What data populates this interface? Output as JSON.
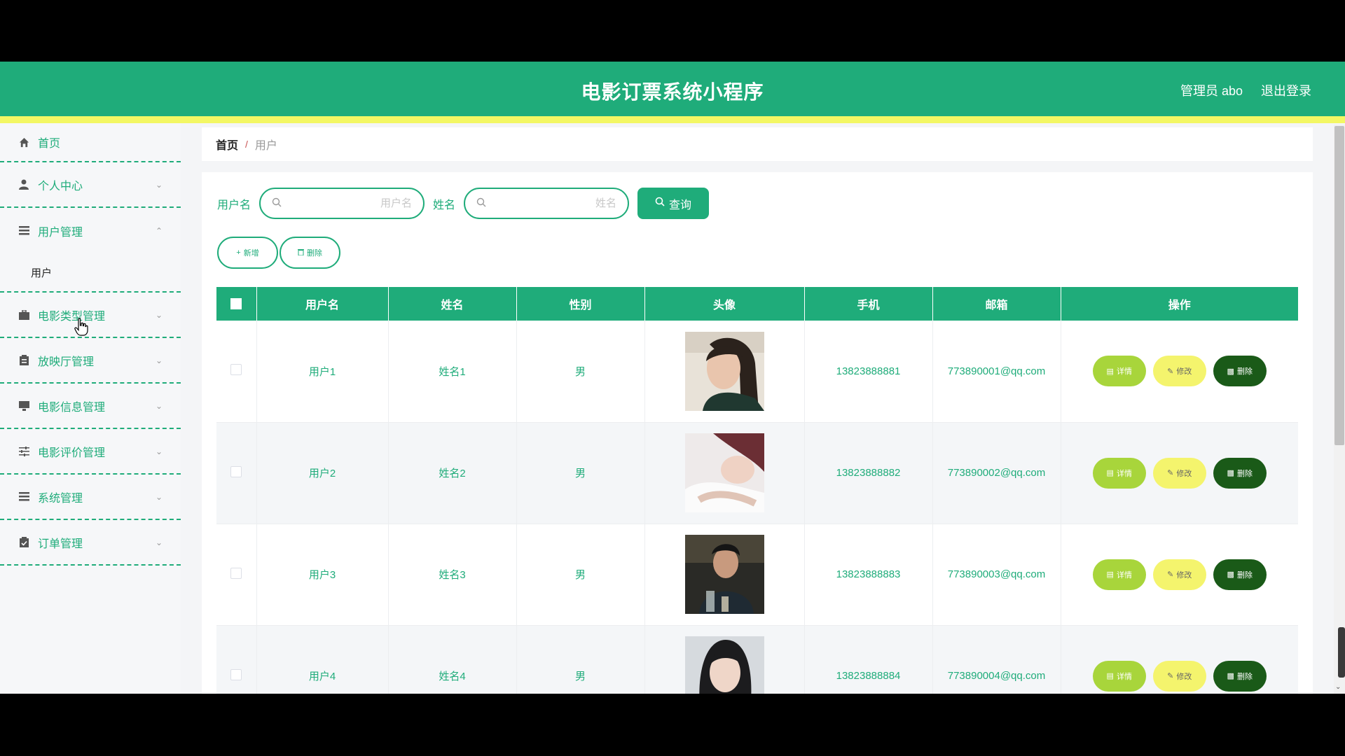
{
  "header": {
    "title": "电影订票系统小程序",
    "admin_label": "管理员 abo",
    "logout_label": "退出登录"
  },
  "sidebar": {
    "items": [
      {
        "label": "首页",
        "icon": "home-icon"
      },
      {
        "label": "个人中心",
        "icon": "user-icon"
      },
      {
        "label": "用户管理",
        "icon": "list-icon",
        "expanded": true,
        "sub": [
          "用户"
        ]
      },
      {
        "label": "电影类型管理",
        "icon": "briefcase-icon"
      },
      {
        "label": "放映厅管理",
        "icon": "clipboard-icon"
      },
      {
        "label": "电影信息管理",
        "icon": "monitor-icon"
      },
      {
        "label": "电影评价管理",
        "icon": "sliders-icon"
      },
      {
        "label": "系统管理",
        "icon": "list-icon"
      },
      {
        "label": "订单管理",
        "icon": "clipboard-check-icon"
      }
    ]
  },
  "breadcrumb": {
    "home": "首页",
    "sep": "/",
    "current": "用户"
  },
  "search": {
    "username_label": "用户名",
    "username_placeholder": "用户名",
    "name_label": "姓名",
    "name_placeholder": "姓名",
    "query_label": "查询"
  },
  "actions": {
    "add_label": "新增",
    "delete_label": "删除"
  },
  "table": {
    "headers": [
      "用户名",
      "姓名",
      "性别",
      "头像",
      "手机",
      "邮箱",
      "操作"
    ],
    "rows": [
      {
        "username": "用户1",
        "name": "姓名1",
        "gender": "男",
        "phone": "13823888881",
        "email": "773890001@qq.com"
      },
      {
        "username": "用户2",
        "name": "姓名2",
        "gender": "男",
        "phone": "13823888882",
        "email": "773890002@qq.com"
      },
      {
        "username": "用户3",
        "name": "姓名3",
        "gender": "男",
        "phone": "13823888883",
        "email": "773890003@qq.com"
      },
      {
        "username": "用户4",
        "name": "姓名4",
        "gender": "男",
        "phone": "13823888884",
        "email": "773890004@qq.com"
      }
    ],
    "ops": {
      "detail": "详情",
      "edit": "修改",
      "delete": "删除"
    }
  },
  "colors": {
    "primary": "#1fac7a",
    "stripe": "#f3f764",
    "detail": "#a8d53b",
    "edit": "#f4f46d",
    "delete": "#1a5a18"
  }
}
